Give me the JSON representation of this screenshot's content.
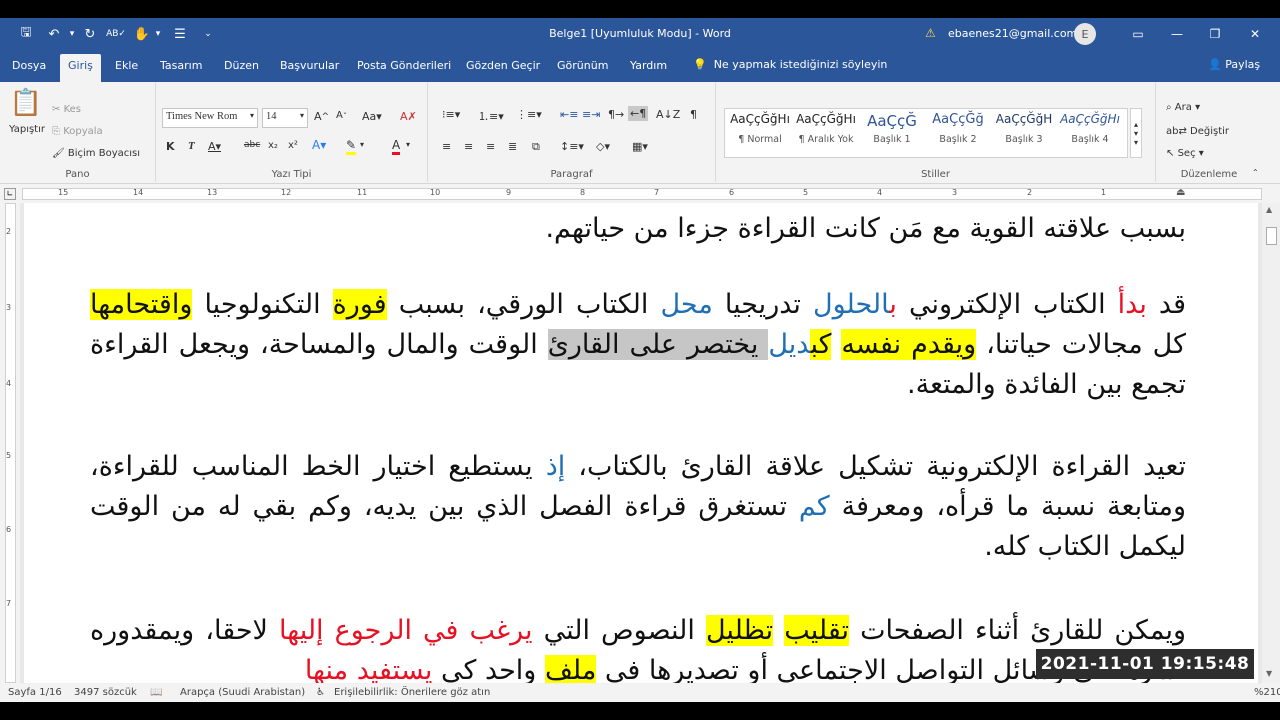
{
  "window": {
    "title": "Belge1 [Uyumluluk Modu]  -  Word",
    "account": "ebaenes21@gmail.com",
    "avatar": "E"
  },
  "tabs": [
    "Dosya",
    "Giriş",
    "Ekle",
    "Tasarım",
    "Düzen",
    "Başvurular",
    "Posta Gönderileri",
    "Gözden Geçir",
    "Görünüm",
    "Yardım"
  ],
  "tell_me": "Ne yapmak istediğinizi söyleyin",
  "share": "Paylaş",
  "ribbon": {
    "clipboard": {
      "label": "Pano",
      "paste": "Yapıştır",
      "cut": "Kes",
      "copy": "Kopyala",
      "painter": "Biçim Boyacısı"
    },
    "font": {
      "label": "Yazı Tipi",
      "name": "Times New Rom",
      "size": "14"
    },
    "paragraph": {
      "label": "Paragraf"
    },
    "styles": {
      "label": "Stiller",
      "items": [
        {
          "preview": "AaÇçĞğHı",
          "name": "¶ Normal"
        },
        {
          "preview": "AaÇçĞğHı",
          "name": "¶ Aralık Yok"
        },
        {
          "preview": "AaÇçĞ",
          "name": "Başlık 1"
        },
        {
          "preview": "AaÇçĞğ",
          "name": "Başlık 2"
        },
        {
          "preview": "AaÇçĞğH",
          "name": "Başlık 3"
        },
        {
          "preview": "AaÇçĞğHı",
          "name": "Başlık 4"
        }
      ]
    },
    "editing": {
      "label": "Düzenleme",
      "find": "Ara",
      "replace": "Değiştir",
      "select": "Seç"
    }
  },
  "ruler": {
    "h": [
      "15",
      "14",
      "13",
      "12",
      "11",
      "10",
      "9",
      "8",
      "7",
      "6",
      "5",
      "4",
      "3",
      "2",
      "1"
    ],
    "v": [
      "2",
      "3",
      "4",
      "5",
      "6",
      "7"
    ]
  },
  "doc": {
    "p1": "بسبب علاقته القوية مع مَن كانت القراءة جزءا من حياتهم.",
    "p2": [
      "قد ",
      "بدأ",
      " الكتاب الإلكتروني ",
      "ب",
      "الحلول",
      " تدريجيا ",
      "محل",
      " الكتاب الورقي، بسبب ",
      "فورة",
      " التكنولوجيا ",
      "واقتحامها",
      " كل مجالات حياتنا، ",
      "ويقدم نفسه",
      " ",
      "كب",
      "",
      "ديل",
      " يختصر على القارئ",
      " الوقت والمال والمساحة، ويجعل القراءة تجمع بين الفائدة والمتعة."
    ],
    "p3": [
      "تعيد القراءة الإلكترونية تشكيل علاقة القارئ بالكتاب، ",
      "إذ",
      " يستطيع اختيار الخط المناسب للقراءة، ومتابعة نسبة ما قرأه، ومعرفة ",
      "كم",
      " تستغرق قراءة الفصل الذي بين يديه، وكم بقي له من الوقت ليكمل الكتاب كله."
    ],
    "p4": [
      "ويمكن للقارئ أثناء الصفحات ",
      "تقليب",
      " ",
      "تظليل",
      " النصوص التي ",
      "يرغب في الرجوع إليها",
      " لاحقا، ويمقدوره نشرها في وسائل التواصل الاجتماعي أو تصديرها في ",
      "ملف",
      " واحد كي ",
      "يستفيد منها",
      ""
    ]
  },
  "status": {
    "page": "Sayfa 1/16",
    "words": "3497 sözcük",
    "language": "Arapça (Suudi Arabistan)",
    "accessibility": "Erişilebilirlik: Önerilere göz atın",
    "zoom": "%210"
  },
  "overlay": {
    "timestamp": "2021-11-01  19:15:48"
  },
  "colors": {
    "title_bar": "#2b579a",
    "highlight": "#ffff00",
    "red_text": "#e81123",
    "blue_text": "#1f6fb5",
    "selection": "#c6c6c6"
  }
}
